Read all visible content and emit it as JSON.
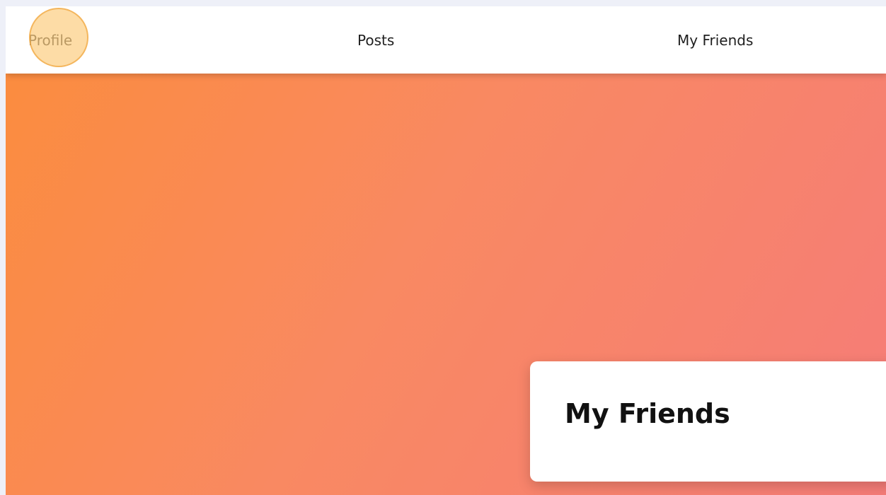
{
  "nav": {
    "items": [
      {
        "label": "Profile",
        "state": "hovered"
      },
      {
        "label": "Posts"
      },
      {
        "label": "My Friends"
      }
    ]
  },
  "hero": {
    "gradient": [
      "#fb8c3f",
      "#f98962",
      "#f57c78"
    ]
  },
  "card": {
    "title": "My Friends"
  },
  "colors": {
    "nav_bg": "#ffffff",
    "page_bg": "#eef0f8",
    "click_marker": "#fbbf5c"
  }
}
